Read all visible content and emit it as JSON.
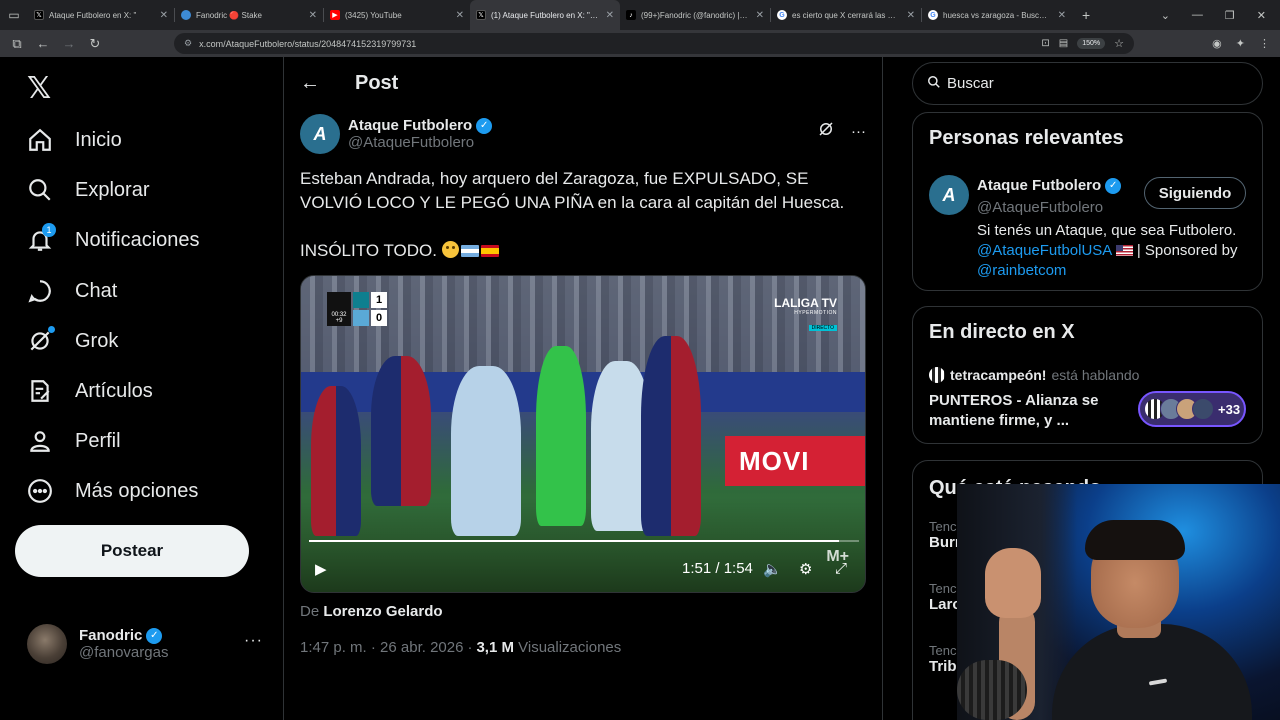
{
  "browser": {
    "tabs": [
      {
        "title": "Ataque Futbolero en X: \"",
        "fav_color": "#000000",
        "fav_glyph": "𝕏",
        "active": false
      },
      {
        "title": "Fanodric 🔴 Stake",
        "fav_color": "#53fc18",
        "fav_glyph": "",
        "active": false
      },
      {
        "title": "(3425) YouTube",
        "fav_color": "#ff0000",
        "fav_glyph": "▶",
        "active": false
      },
      {
        "title": "(1) Ataque Futbolero en X: \"Este",
        "fav_color": "#000000",
        "fav_glyph": "𝕏",
        "active": true
      },
      {
        "title": "(99+)Fanodric (@fanodric) | Tik",
        "fav_color": "#000000",
        "fav_glyph": "♪",
        "active": false
      },
      {
        "title": "es cierto que X cerrará las Com",
        "fav_color": "#4285f4",
        "fav_glyph": "G",
        "active": false
      },
      {
        "title": "huesca vs zaragoza - Buscar co",
        "fav_color": "#4285f4",
        "fav_glyph": "G",
        "active": false
      }
    ],
    "url": "x.com/AtaqueFutbolero/status/2048474152319799731",
    "zoom": "150%"
  },
  "nav": {
    "items": [
      {
        "label": "Inicio",
        "icon": "home-icon"
      },
      {
        "label": "Explorar",
        "icon": "search-icon"
      },
      {
        "label": "Notificaciones",
        "icon": "bell-icon",
        "badge": "1"
      },
      {
        "label": "Chat",
        "icon": "chat-icon"
      },
      {
        "label": "Grok",
        "icon": "grok-icon"
      },
      {
        "label": "Artículos",
        "icon": "articles-icon"
      },
      {
        "label": "Perfil",
        "icon": "profile-icon"
      },
      {
        "label": "Más opciones",
        "icon": "more-icon"
      }
    ],
    "post_label": "Postear",
    "account": {
      "name": "Fanodric",
      "handle": "@fanovargas"
    }
  },
  "main": {
    "title": "Post",
    "author": {
      "name": "Ataque Futbolero",
      "handle": "@AtaqueFutbolero"
    },
    "text_line1": "Esteban Andrada, hoy arquero del Zaragoza, fue EXPULSADO, SE VOLVIÓ LOCO Y LE PEGÓ UNA PIÑA en la cara al capitán del Huesca.",
    "text_line2": "INSÓLITO TODO.",
    "video": {
      "score_home": "1",
      "score_away": "0",
      "match_clock": "00:32",
      "added_time": "+9",
      "broadcaster": "LALIGA TV",
      "broadcaster_sub": "HYPERMOTION",
      "broadcaster_live": "DIRECTO",
      "time_display": "1:51 / 1:54",
      "progress": 0.964
    },
    "from_prefix": "De",
    "from_name": "Lorenzo Gelardo",
    "timestamp": "1:47 p. m. · 26 abr. 2026",
    "views_count": "3,1 M",
    "views_label": "Visualizaciones"
  },
  "right": {
    "search_placeholder": "Buscar",
    "relevant": {
      "title": "Personas relevantes",
      "name": "Ataque Futbolero",
      "handle": "@AtaqueFutbolero",
      "follow_label": "Siguiendo",
      "bio_text": "Si tenés un Ataque, que sea Futbolero.",
      "bio_link1": "@AtaqueFutbolUSA",
      "bio_mid": "| Sponsored by",
      "bio_link2": "@rainbetcom"
    },
    "live": {
      "title": "En directo en X",
      "host": "tetracampeón!",
      "host_suffix": "está hablando",
      "space_title": "PUNTEROS - Alianza se mantiene firme, y ...",
      "listeners": "+33"
    },
    "trends": {
      "title": "Qué está pasando",
      "items": [
        {
          "category": "Tenc",
          "name": "Burn"
        },
        {
          "category": "Tenc",
          "name": "Larc"
        },
        {
          "category": "Tenc",
          "name": "Trib"
        }
      ]
    }
  }
}
